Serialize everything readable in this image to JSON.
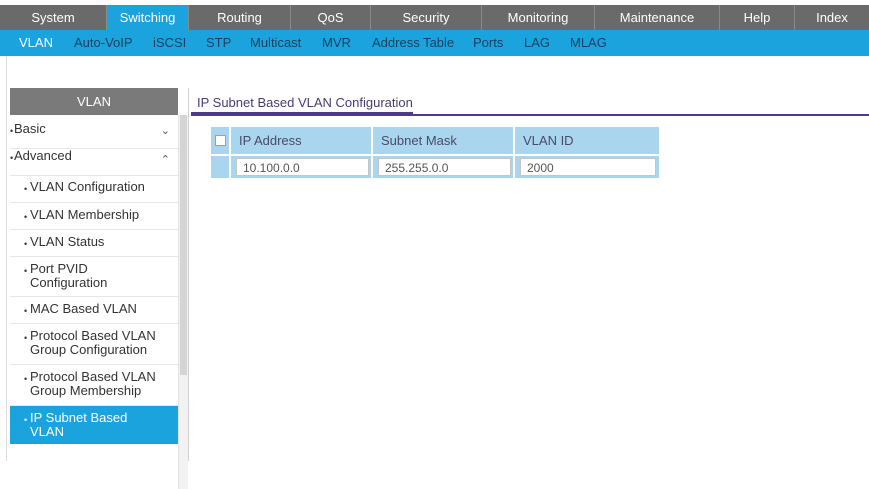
{
  "top_nav": {
    "tabs": [
      {
        "label": "System"
      },
      {
        "label": "Switching",
        "active": true
      },
      {
        "label": "Routing"
      },
      {
        "label": "QoS"
      },
      {
        "label": "Security"
      },
      {
        "label": "Monitoring"
      },
      {
        "label": "Maintenance"
      },
      {
        "label": "Help"
      },
      {
        "label": "Index"
      }
    ]
  },
  "sub_nav": {
    "items": [
      {
        "label": "VLAN",
        "active": true
      },
      {
        "label": "Auto-VoIP"
      },
      {
        "label": "iSCSI"
      },
      {
        "label": "STP"
      },
      {
        "label": "Multicast"
      },
      {
        "label": "MVR"
      },
      {
        "label": "Address Table"
      },
      {
        "label": "Ports"
      },
      {
        "label": "LAG"
      },
      {
        "label": "MLAG"
      }
    ]
  },
  "sidebar": {
    "header": "VLAN",
    "items": [
      {
        "label": "Basic"
      },
      {
        "label": "Advanced"
      },
      {
        "label": "VLAN Configuration"
      },
      {
        "label": "VLAN Membership"
      },
      {
        "label": "VLAN Status"
      },
      {
        "label": "Port PVID Configuration"
      },
      {
        "label": "MAC Based VLAN"
      },
      {
        "label": "Protocol Based VLAN Group Configuration"
      },
      {
        "label": "Protocol Based VLAN Group Membership"
      },
      {
        "label": "IP Subnet Based VLAN",
        "active": true
      }
    ],
    "basic_chevron": "⌄",
    "advanced_chevron": "⌃",
    "bullet": "•"
  },
  "main": {
    "title": "IP Subnet Based VLAN Configuration",
    "table": {
      "headers": [
        "IP Address",
        "Subnet Mask",
        "VLAN ID"
      ],
      "row": {
        "ip_address": "10.100.0.0",
        "subnet_mask": "255.255.0.0",
        "vlan_id": "2000"
      }
    }
  },
  "colors": {
    "accent": "#1aa3dc",
    "nav_gray": "#6a6a6a",
    "table_header": "#aad5ee",
    "title_purple": "#4c3b8a"
  }
}
